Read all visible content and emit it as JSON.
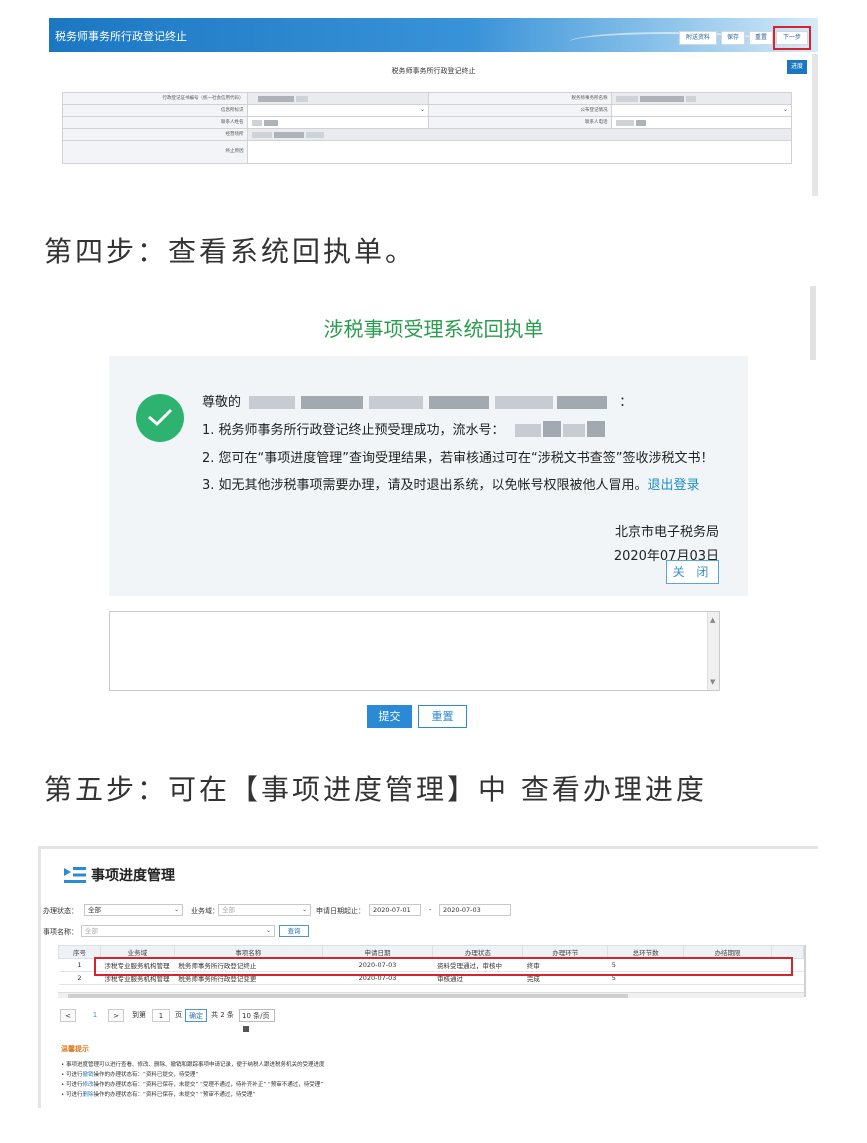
{
  "form": {
    "app_title": "税务师事务所行政登记终止",
    "toolbar": {
      "reference_label": "附送资料",
      "save_label": "保存",
      "reset_label": "重置",
      "next_label": "下一步"
    },
    "progress_label": "进度",
    "form_title": "税务师事务所行政登记终止",
    "fields": {
      "admin_reg_code": "行政登记证书编号（统一社会信用代码）",
      "firm_name": "税务师事务所名称",
      "credit_id": "信息所标识",
      "public_reg": "公布登记情况",
      "contact_name": "联系人姓名",
      "contact_phone": "联系人电话",
      "office_addr": "经营场所",
      "term_reason": "终止原因"
    }
  },
  "step4": "第四步：查看系统回执单。",
  "receipt": {
    "title": "涉税事项受理系统回执单",
    "greeting": "尊敬的",
    "greeting_end": "：",
    "line1": "1. 税务师事务所行政登记终止预受理成功，流水号：",
    "line2": "2. 您可在“事项进度管理”查询受理结果，若审核通过可在“涉税文书查签”签收涉税文书！",
    "line3": "3. 如无其他涉税事项需要办理，请及时退出系统，以免帐号权限被他人冒用。",
    "logout_link": "退出登录",
    "org": "北京市电子税务局",
    "date": "2020年07月03日",
    "close_label": "关 闭",
    "submit_label": "提交",
    "reset_label": "重置"
  },
  "step5": "第五步：可在【事项进度管理】中 查看办理进度",
  "progress": {
    "title": "事项进度管理",
    "filters": {
      "status_label": "办理状态：",
      "status_value": "全部",
      "domain_label": "业务域：",
      "domain_value": "全部",
      "date_label": "申请日期起止：",
      "date_from": "2020-07-01",
      "date_sep": "-",
      "date_to": "2020-07-03",
      "item_label": "事项名称：",
      "item_value": "全部",
      "query_label": "查询"
    },
    "columns": [
      "序号",
      "业务域",
      "事项名称",
      "申请日期",
      "办理状态",
      "办理环节",
      "总环节数",
      "办结期限"
    ],
    "rows": [
      [
        "1",
        "涉税专业服务机构管理",
        "税务师事务所行政登记终止",
        "2020-07-03",
        "资料受理通过，审核中",
        "终审",
        "5",
        ""
      ],
      [
        "2",
        "涉税专业服务机构管理",
        "税务师事务所行政登记变更",
        "2020-07-03",
        "审核通过",
        "完成",
        "5",
        ""
      ]
    ],
    "pager": {
      "prev": "<",
      "current": "1",
      "next": ">",
      "goto_label": "到第",
      "goto_value": "1",
      "page_unit": "页",
      "confirm_label": "确定",
      "total": "共 2 条",
      "page_size": "10 条/页"
    },
    "tips_title": "温馨提示",
    "tips": [
      {
        "pre": "• 事项进度管理可以进行查看、修改、删除、撤销和跟踪事项申请记录，便于纳税人跟进税务机关的受理进度",
        "link": "",
        "post": ""
      },
      {
        "pre": "• 可进行",
        "link": "撤销",
        "post": "操作的办理状态有：“资料已提交，待受理”"
      },
      {
        "pre": "• 可进行",
        "link": "修改",
        "post": "操作的办理状态有：“资料已保存，未提交” “受理不通过，待补齐补正” “预审不通过，待受理”"
      },
      {
        "pre": "• 可进行",
        "link": "删除",
        "post": "操作的办理状态有：“资料已保存，未提交” “预审不通过，待受理”"
      }
    ]
  },
  "colors": {
    "accent_blue": "#1c77c3",
    "highlight_red": "#d8232a",
    "success_green": "#2db36f",
    "title_green": "#2a9d4f"
  }
}
